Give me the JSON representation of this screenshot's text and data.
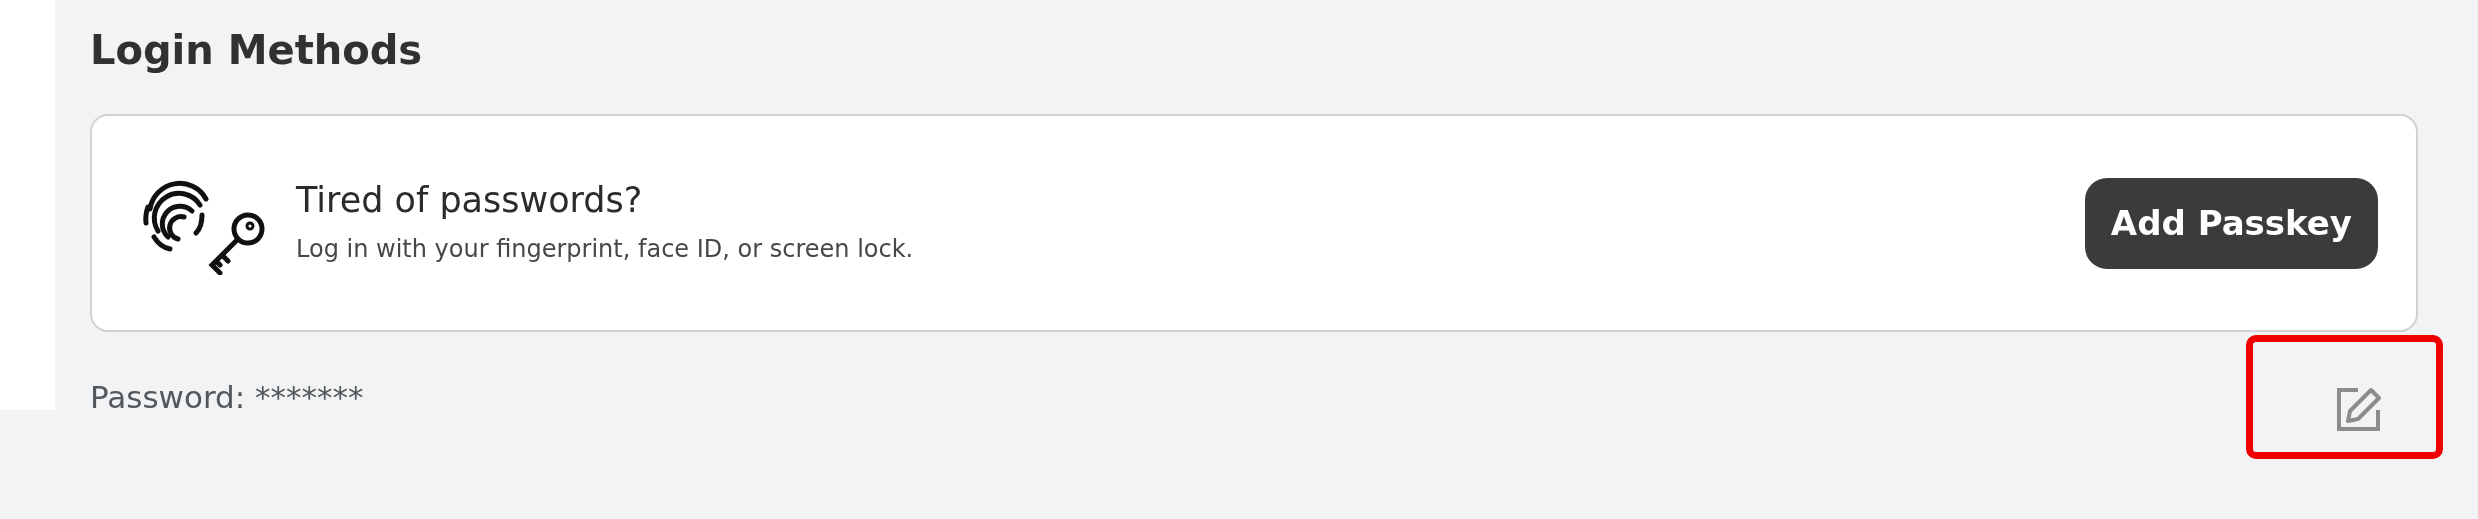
{
  "section": {
    "title": "Login Methods"
  },
  "passkey_card": {
    "title": "Tired of passwords?",
    "description": "Log in with your fingerprint, face ID, or screen lock.",
    "button": "Add Passkey"
  },
  "password": {
    "label": "Password:",
    "value": "*******",
    "edit_highlighted": true
  }
}
